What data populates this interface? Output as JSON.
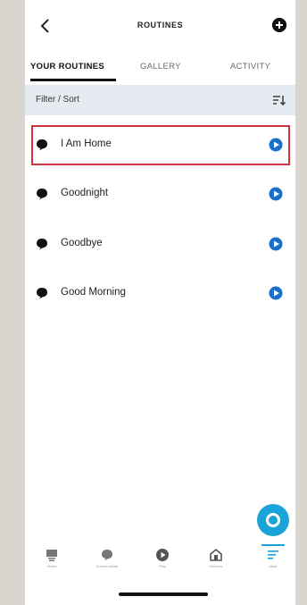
{
  "header": {
    "title": "ROUTINES",
    "back_icon": "chevron-left-icon",
    "add_icon": "plus-circle-icon"
  },
  "tabs": [
    {
      "label": "YOUR ROUTINES",
      "active": true
    },
    {
      "label": "GALLERY",
      "active": false
    },
    {
      "label": "ACTIVITY",
      "active": false
    }
  ],
  "filter": {
    "label": "Filter / Sort",
    "icon": "sort-icon"
  },
  "routines": [
    {
      "label": "I Am Home",
      "icon": "speech-bubble-icon",
      "action_icon": "play-icon",
      "highlighted": true
    },
    {
      "label": "Goodnight",
      "icon": "speech-bubble-icon",
      "action_icon": "play-icon",
      "highlighted": false
    },
    {
      "label": "Goodbye",
      "icon": "speech-bubble-icon",
      "action_icon": "play-icon",
      "highlighted": false
    },
    {
      "label": "Good Morning",
      "icon": "speech-bubble-icon",
      "action_icon": "play-icon",
      "highlighted": false
    }
  ],
  "alexa_button": {
    "icon": "alexa-ring-icon"
  },
  "bottom_nav": {
    "items": [
      {
        "label": "Home",
        "icon": "home-icon"
      },
      {
        "label": "Communicate",
        "icon": "chat-icon"
      },
      {
        "label": "Play",
        "icon": "play-icon"
      },
      {
        "label": "Devices",
        "icon": "devices-icon"
      },
      {
        "label": "More",
        "icon": "more-icon",
        "active": true
      }
    ]
  },
  "colors": {
    "accent": "#1aa3d8",
    "highlight_border": "#d0353f",
    "play_button": "#1a6fc9",
    "filter_bar": "#e5ebf0"
  }
}
